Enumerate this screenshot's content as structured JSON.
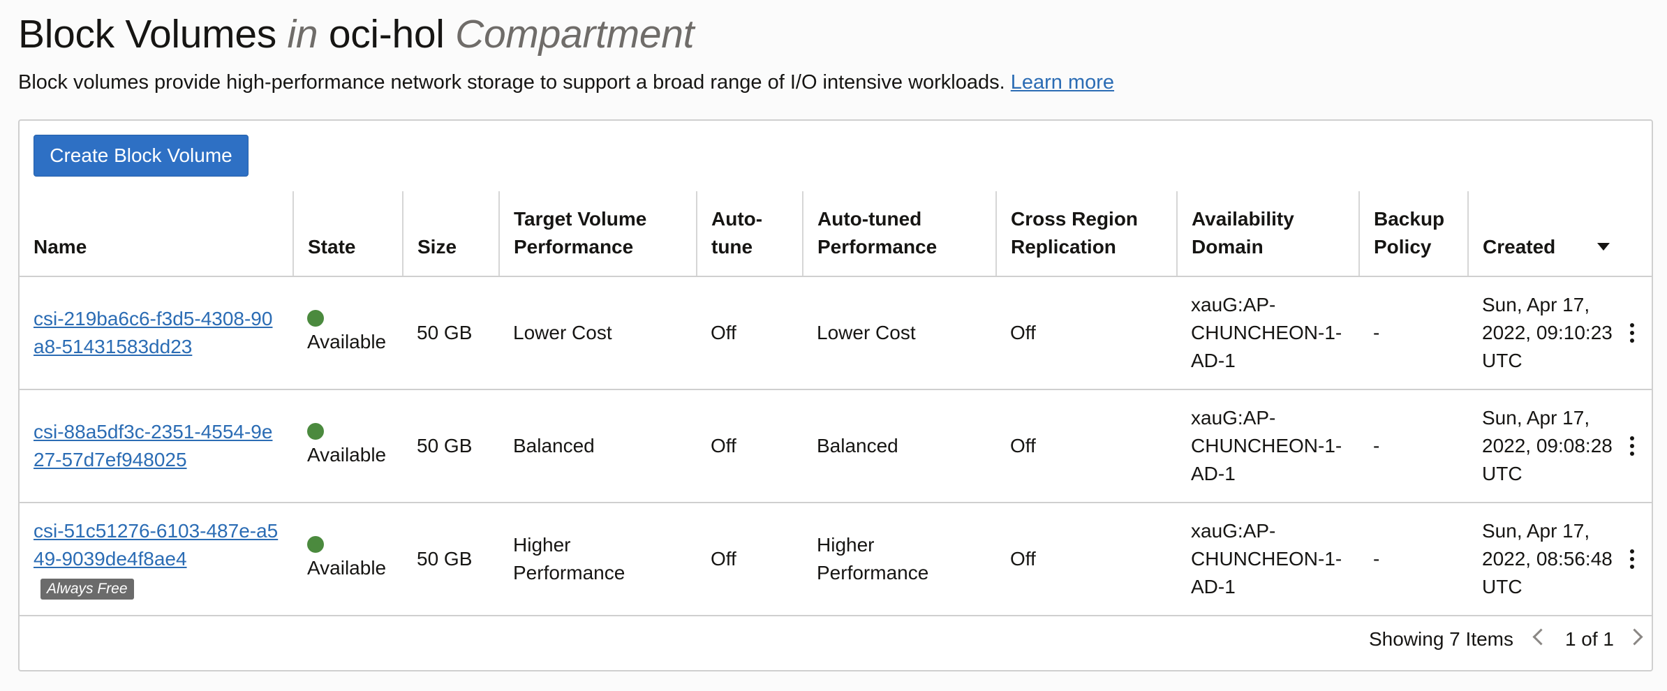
{
  "header": {
    "title_main": "Block Volumes",
    "title_in": "in",
    "compartment_name": "oci-hol",
    "compartment_label": "Compartment",
    "description": "Block volumes provide high-performance network storage to support a broad range of I/O intensive workloads.",
    "learn_more": "Learn more"
  },
  "toolbar": {
    "create_label": "Create Block Volume"
  },
  "table": {
    "columns": [
      "Name",
      "State",
      "Size",
      "Target Volume Performance",
      "Auto-tune",
      "Auto-tuned Performance",
      "Cross Region Replication",
      "Availability Domain",
      "Backup Policy",
      "Created"
    ],
    "sorted_column": "Created",
    "sort_direction": "descending",
    "rows": [
      {
        "name": "csi-219ba6c6-f3d5-4308-90a8-51431583dd23",
        "state": "Available",
        "size": "50 GB",
        "target_performance": "Lower Cost",
        "auto_tune": "Off",
        "auto_tuned_performance": "Lower Cost",
        "cross_region_replication": "Off",
        "availability_domain": "xauG:AP-CHUNCHEON-1-AD-1",
        "backup_policy": "-",
        "created": "Sun, Apr 17, 2022, 09:10:23 UTC",
        "badge": ""
      },
      {
        "name": "csi-88a5df3c-2351-4554-9e27-57d7ef948025",
        "state": "Available",
        "size": "50 GB",
        "target_performance": "Balanced",
        "auto_tune": "Off",
        "auto_tuned_performance": "Balanced",
        "cross_region_replication": "Off",
        "availability_domain": "xauG:AP-CHUNCHEON-1-AD-1",
        "backup_policy": "-",
        "created": "Sun, Apr 17, 2022, 09:08:28 UTC",
        "badge": ""
      },
      {
        "name": "csi-51c51276-6103-487e-a549-9039de4f8ae4",
        "state": "Available",
        "size": "50 GB",
        "target_performance": "Higher Performance",
        "auto_tune": "Off",
        "auto_tuned_performance": "Higher Performance",
        "cross_region_replication": "Off",
        "availability_domain": "xauG:AP-CHUNCHEON-1-AD-1",
        "backup_policy": "-",
        "created": "Sun, Apr 17, 2022, 08:56:48 UTC",
        "badge": "Always Free"
      }
    ]
  },
  "footer": {
    "showing": "Showing 7 Items",
    "pagination": "1 of 1"
  },
  "colors": {
    "accent": "#2e70c4",
    "link": "#2b6cb4",
    "status_available": "#4b8a3e",
    "badge_bg": "#6b6b6b"
  },
  "icons": {
    "status": "status-dot-icon",
    "sort": "sort-descending-icon",
    "row_actions": "kebab-menu-icon",
    "prev": "chevron-left-icon",
    "next": "chevron-right-icon"
  }
}
